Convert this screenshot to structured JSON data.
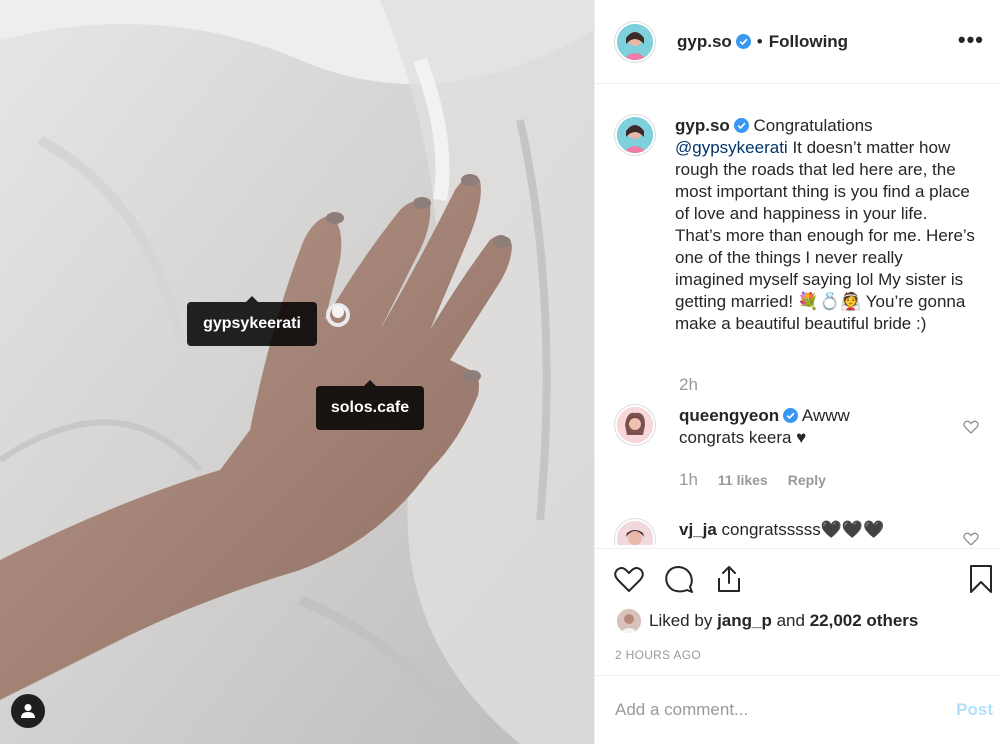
{
  "photo": {
    "tags": [
      "gypsykeerati",
      "solos.cafe"
    ]
  },
  "header": {
    "username": "gyp.so",
    "separator": "•",
    "follow_status": "Following",
    "more": "•••"
  },
  "caption": {
    "username": "gyp.so",
    "text_before": "Congratulations",
    "mention": "@gypsykeerati",
    "text_after": "It doesn’t matter how rough the roads that led here are, the most important thing is you find a place of love and happiness in your life. That’s more than enough for me. Here’s one of the things I never really imagined myself saying lol My sister is getting married! 💐💍👰 You’re gonna make a beautiful beautiful bride :)",
    "time": "2h"
  },
  "comments": [
    {
      "username": "queengyeon",
      "text": "Awww congrats keera ♥",
      "time": "1h",
      "likes": "11 likes",
      "reply": "Reply"
    },
    {
      "username": "vj_ja",
      "text": "congratsssss🖤🖤🖤"
    }
  ],
  "likes": {
    "prefix": "Liked by",
    "user": "jang_p",
    "conj": "and",
    "others": "22,002 others"
  },
  "timestamp": "2 HOURS AGO",
  "add_comment": {
    "placeholder": "Add a comment...",
    "post": "Post"
  },
  "colors": {
    "verified": "#3897f0",
    "post_disabled": "#b2dffc",
    "muted": "#999999"
  }
}
